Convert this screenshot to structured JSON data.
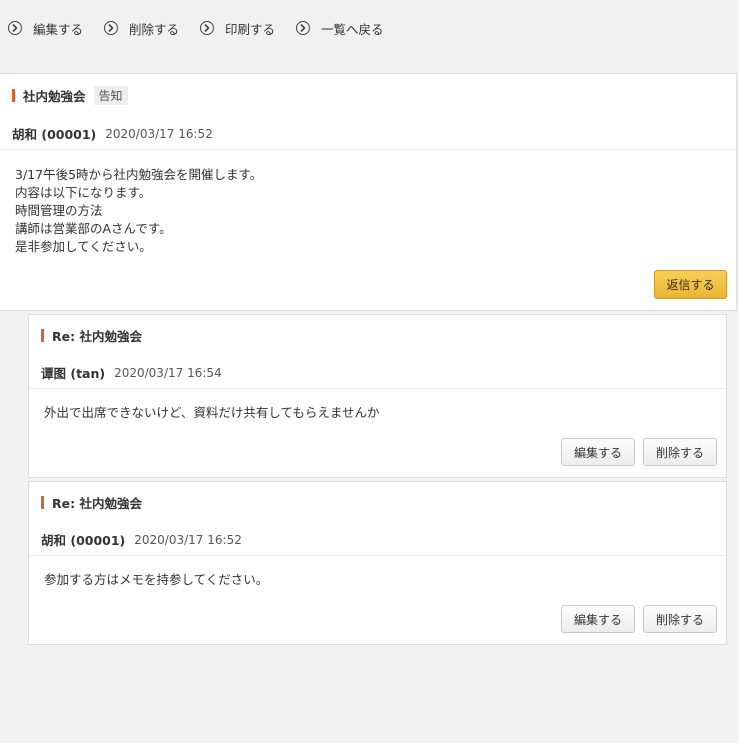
{
  "toolbar": {
    "edit": "編集する",
    "delete": "削除する",
    "print": "印刷する",
    "back": "一覧へ戻る"
  },
  "main_post": {
    "title": "社内勉強会",
    "tag": "告知",
    "author": "胡和 (00001)",
    "date": "2020/03/17 16:52",
    "lines": [
      "3/17午後5時から社内勉強会を開催します。",
      "内容は以下になります。",
      "時間管理の方法",
      "講師は営業部のAさんです。",
      "是非参加してください。"
    ],
    "reply_label": "返信する"
  },
  "replies": [
    {
      "title": "Re: 社内勉強会",
      "author": "谭图 (tan)",
      "date": "2020/03/17 16:54",
      "body": "外出で出席できないけど、資料だけ共有してもらえませんか",
      "edit_label": "編集する",
      "delete_label": "削除する"
    },
    {
      "title": "Re: 社内勉強会",
      "author": "胡和 (00001)",
      "date": "2020/03/17 16:52",
      "body": "参加する方はメモを持参してください。",
      "edit_label": "編集する",
      "delete_label": "削除する"
    }
  ],
  "colors": {
    "background": "#f1f1f1",
    "accent_bar": "#e0602a",
    "reply_button": "#f0c040"
  }
}
